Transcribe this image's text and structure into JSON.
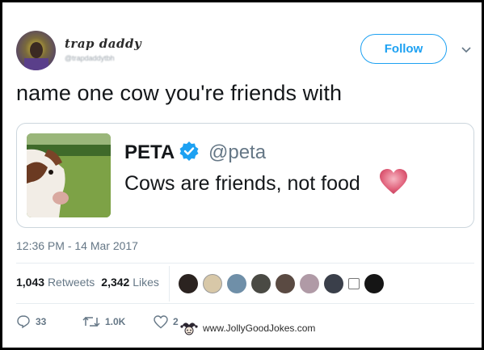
{
  "tweet": {
    "display_name": "trap daddy",
    "handle": "@trapdaddytbh",
    "follow_label": "Follow",
    "text": "name one cow you're friends with",
    "timestamp": "12:36 PM - 14 Mar 2017"
  },
  "quote": {
    "name": "PETA",
    "handle": "@peta",
    "text": "Cows are friends, not food"
  },
  "stats": {
    "retweets_count": "1,043",
    "retweets_label": "Retweets",
    "likes_count": "2,342",
    "likes_label": "Likes"
  },
  "actions": {
    "replies": "33",
    "retweets": "1.0K",
    "likes": "2"
  },
  "watermark": {
    "text": "www.JollyGoodJokes.com"
  },
  "colors": {
    "accent": "#1da1f2",
    "muted": "#657786",
    "border": "#ccd6dd"
  }
}
